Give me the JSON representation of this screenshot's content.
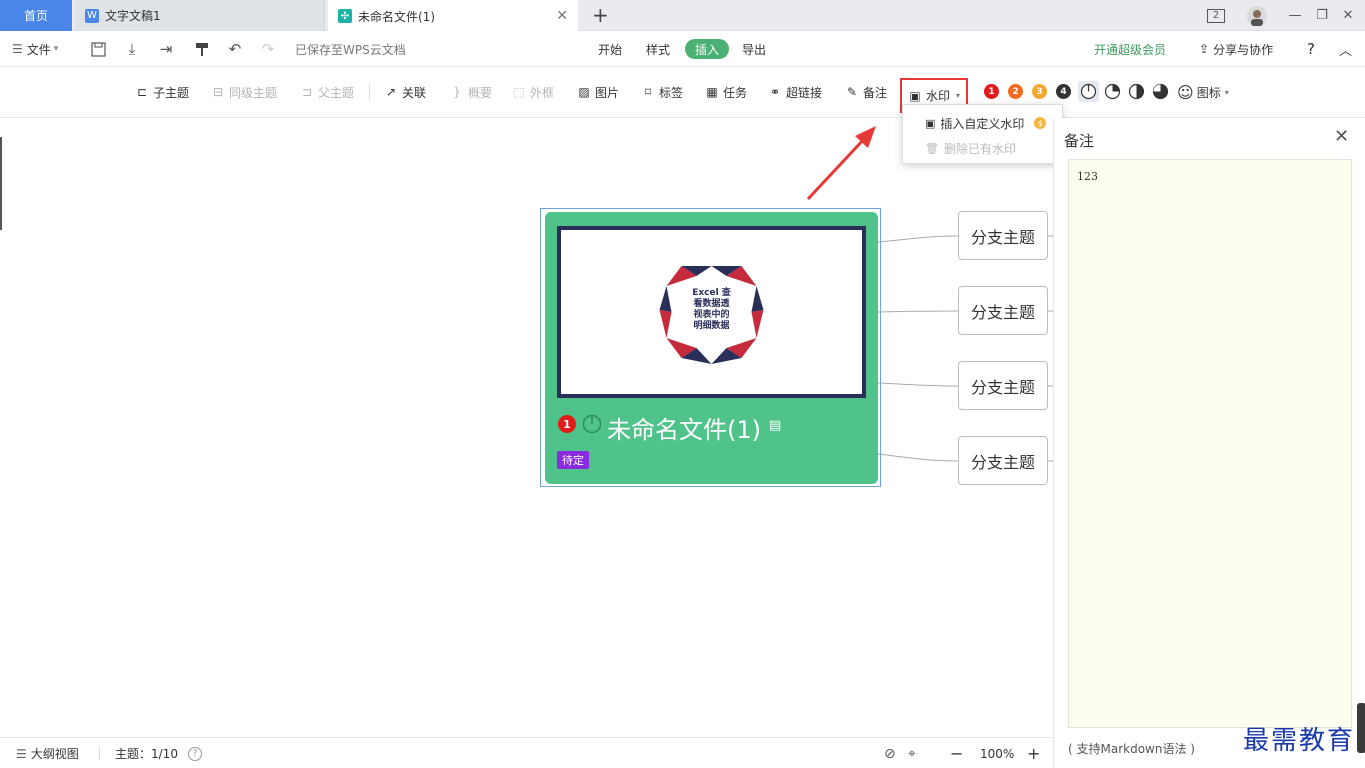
{
  "titlebar": {
    "tabs": [
      {
        "label": "首页"
      },
      {
        "label": "文字文稿1"
      },
      {
        "label": "未命名文件(1)"
      }
    ],
    "window_count": "2"
  },
  "menubar": {
    "file": "文件",
    "save_status": "已保存至WPS云文档",
    "menus": [
      "开始",
      "样式",
      "插入",
      "导出"
    ],
    "vip": "开通超级会员",
    "share": "分享与协作",
    "help": "?"
  },
  "toolbar": {
    "sub_topic": "子主题",
    "sibling_topic": "同级主题",
    "parent_topic": "父主题",
    "relation": "关联",
    "summary": "概要",
    "boundary": "外框",
    "image": "图片",
    "label": "标签",
    "task": "任务",
    "hyperlink": "超链接",
    "note": "备注",
    "watermark": "水印",
    "priorities": [
      "1",
      "2",
      "3",
      "4"
    ],
    "icons": "图标"
  },
  "dropdown": {
    "insert_custom": "插入自定义水印",
    "delete_existing": "删除已有水印"
  },
  "mindmap": {
    "root_title": "未命名文件(1)",
    "root_image_text": [
      "Excel 查",
      "看数据透",
      "视表中的",
      "明细数据"
    ],
    "root_tag": "待定",
    "root_priority": "1",
    "branches": [
      "分支主题",
      "分支主题",
      "分支主题",
      "分支主题"
    ]
  },
  "notes": {
    "title": "备注",
    "content": "123",
    "hint": "( 支持Markdown语法 )",
    "brand": "最需教育"
  },
  "statusbar": {
    "outline": "大纲视图",
    "topic_count": "主题：1/10",
    "zoom": "100%"
  },
  "colors": {
    "accent_green": "#4bb073",
    "node_green": "#4fc38a",
    "tab_blue": "#4a86e8",
    "highlight_red": "#e53935",
    "tag_purple": "#8a2be2"
  }
}
